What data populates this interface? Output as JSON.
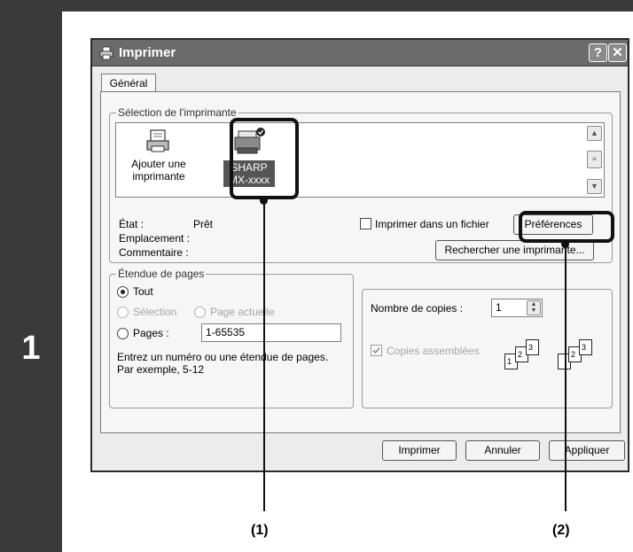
{
  "step_number": "1",
  "dialog": {
    "title": "Imprimer",
    "help_button": "?",
    "close_button": "✕",
    "tab_general": "Général"
  },
  "printer_selection": {
    "group_title": "Sélection de l'imprimante",
    "add_printer_line1": "Ajouter une",
    "add_printer_line2": "imprimante",
    "sharp_line1": "SHARP",
    "sharp_line2": "MX-xxxx"
  },
  "status": {
    "etat_label": "État :",
    "etat_value": "Prêt",
    "emplacement_label": "Emplacement :",
    "commentaire_label": "Commentaire :",
    "print_to_file": "Imprimer dans un fichier",
    "preferences_button": "Préférences",
    "find_printer_button": "Rechercher une imprimante..."
  },
  "page_range": {
    "group_title": "Étendue de pages",
    "all": "Tout",
    "selection": "Sélection",
    "current_page": "Page actuelle",
    "pages": "Pages :",
    "pages_value": "1-65535",
    "hint_line1": "Entrez un numéro ou une étendue de pages.",
    "hint_line2": "Par exemple, 5-12"
  },
  "copies": {
    "number_label": "Nombre de copies :",
    "number_value": "1",
    "collate": "Copies assemblées",
    "collate_checked": true
  },
  "buttons": {
    "print": "Imprimer",
    "cancel": "Annuler",
    "apply": "Appliquer"
  },
  "callouts": {
    "c1": "(1)",
    "c2": "(2)"
  }
}
